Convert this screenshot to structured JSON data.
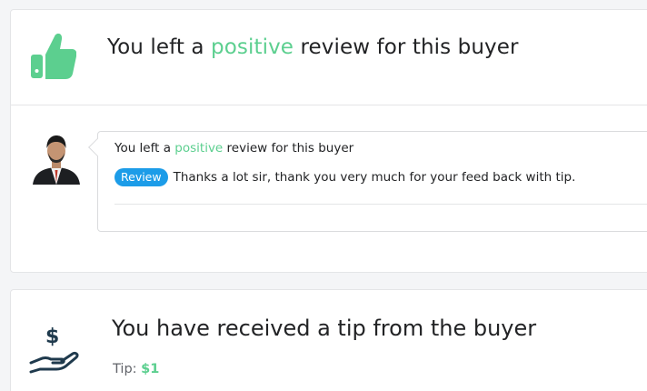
{
  "review_card": {
    "title_prefix": "You left a ",
    "title_highlight": "positive",
    "title_suffix": " review for this buyer",
    "icon": "thumbs-up-icon",
    "message": {
      "avatar": "buyer-avatar",
      "title_prefix": "You left a ",
      "title_highlight": "positive",
      "title_suffix": " review for this buyer",
      "badge": "Review",
      "text": "Thanks a lot sir, thank you very much for your feed back with tip."
    }
  },
  "tip_card": {
    "icon": "dollar-hand-icon",
    "title": "You have received a tip from the buyer",
    "tip_label": "Tip:",
    "tip_amount": "$1"
  },
  "colors": {
    "accent_green": "#5ccf8f",
    "badge_blue": "#1c9ce8",
    "icon_dark": "#1f3a4d"
  }
}
